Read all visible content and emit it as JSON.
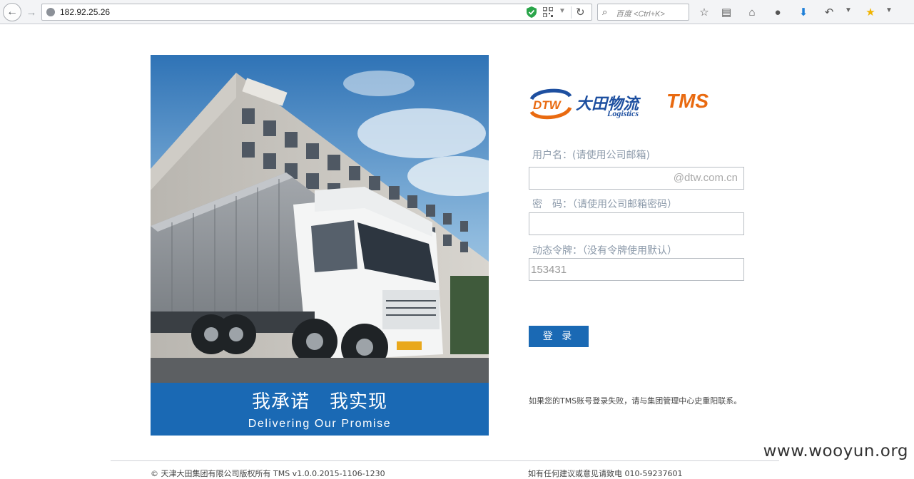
{
  "browser": {
    "url": "182.92.25.26",
    "search_placeholder": "百度 <Ctrl+K>"
  },
  "hero": {
    "slogan_cn_1": "我承诺",
    "slogan_cn_2": "我实现",
    "slogan_en": "Delivering Our Promise",
    "banner_color": "#1a69b4"
  },
  "logo": {
    "badge": "DTW",
    "name_cn": "大田物流",
    "name_en": "Logistics",
    "product": "TMS"
  },
  "form": {
    "username_label": "用户名：(请使用公司邮箱)",
    "username_suffix": "@dtw.com.cn",
    "password_label": "密　码：（请使用公司邮箱密码）",
    "token_label": "动态令牌：（没有令牌使用默认）",
    "token_value": "153431",
    "login_button": "登 录"
  },
  "notice": "如果您的TMS账号登录失败，请与集团管理中心史重阳联系。",
  "footer": {
    "left": "© 天津大田集团有限公司版权所有 TMS v1.0.0.2015-1106-1230",
    "right": "如有任何建议或意见请致电 010-59237601"
  },
  "watermark": "www.wooyun.org",
  "colors": {
    "accent_blue": "#1a69b4",
    "logo_orange": "#e96a10",
    "label_grey": "#8c9aaa"
  }
}
